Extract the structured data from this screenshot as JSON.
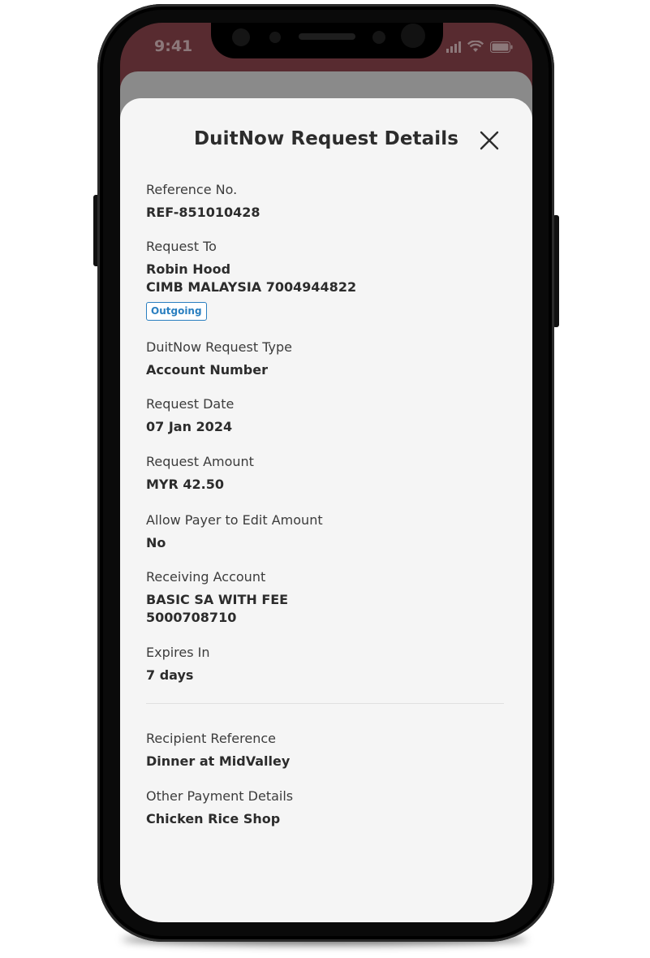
{
  "status_bar": {
    "time": "9:41"
  },
  "sheet": {
    "title": "DuitNow Request Details",
    "close_icon": "close-icon"
  },
  "details": {
    "reference_no": {
      "label": "Reference No.",
      "value": "REF-851010428"
    },
    "request_to": {
      "label": "Request To",
      "name": "Robin Hood",
      "account": "CIMB MALAYSIA 7004944822",
      "badge": "Outgoing"
    },
    "request_type": {
      "label": "DuitNow Request Type",
      "value": "Account Number"
    },
    "request_date": {
      "label": "Request Date",
      "value": "07 Jan 2024"
    },
    "request_amount": {
      "label": "Request Amount",
      "value": "MYR 42.50"
    },
    "allow_edit": {
      "label": "Allow Payer to Edit Amount",
      "value": "No"
    },
    "receiving_account": {
      "label": "Receiving Account",
      "account_name": "BASIC SA WITH FEE",
      "account_number": "5000708710"
    },
    "expires_in": {
      "label": "Expires In",
      "value": "7 days"
    },
    "recipient_reference": {
      "label": "Recipient Reference",
      "value": "Dinner at MidValley"
    },
    "other_payment_details": {
      "label": "Other Payment Details",
      "value": "Chicken Rice Shop"
    }
  },
  "colors": {
    "badge_accent": "#2a7fc0",
    "header_background": "#7a3c43",
    "sheet_background": "#f5f5f5"
  }
}
